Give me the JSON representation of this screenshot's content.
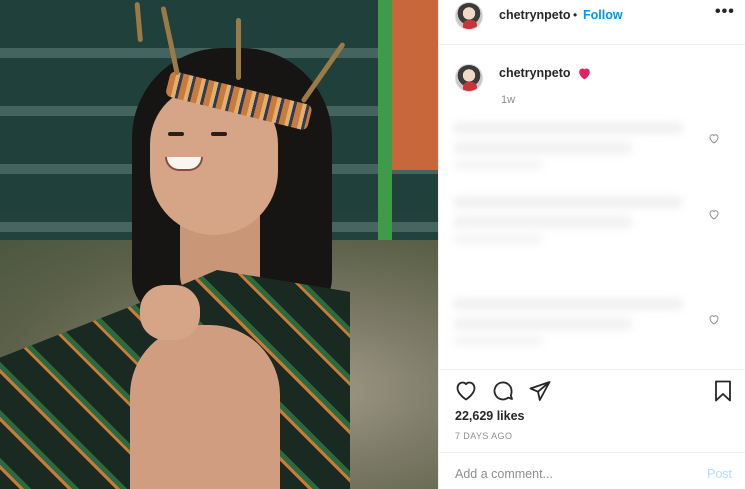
{
  "post": {
    "image_alt": "Photo of a smiling girl wearing a traditional headdress and woven shawl",
    "author": {
      "username": "chetrynpeto",
      "follow_label": "Follow",
      "separator": "•"
    },
    "more_icon": "more-horizontal-icon",
    "caption": {
      "username": "chetrynpeto",
      "badge_icon": "red-heart-emoji-icon",
      "time_ago": "1w"
    },
    "comments": [
      {
        "like_icon": "heart-outline-icon"
      },
      {
        "like_icon": "heart-outline-icon"
      },
      {
        "like_icon": "heart-outline-icon"
      }
    ],
    "actions": {
      "like_icon": "heart-outline-icon",
      "comment_icon": "comment-bubble-icon",
      "share_icon": "paper-plane-icon",
      "save_icon": "bookmark-icon"
    },
    "likes_text": "22,629 likes",
    "date_text": "7 DAYS AGO",
    "comment_input": {
      "placeholder": "Add a comment...",
      "post_label": "Post"
    }
  },
  "colors": {
    "link_blue": "#0095f6",
    "post_disabled": "#b2dffc",
    "muted": "#8e8e8e",
    "heart_red": "#e0245e"
  }
}
